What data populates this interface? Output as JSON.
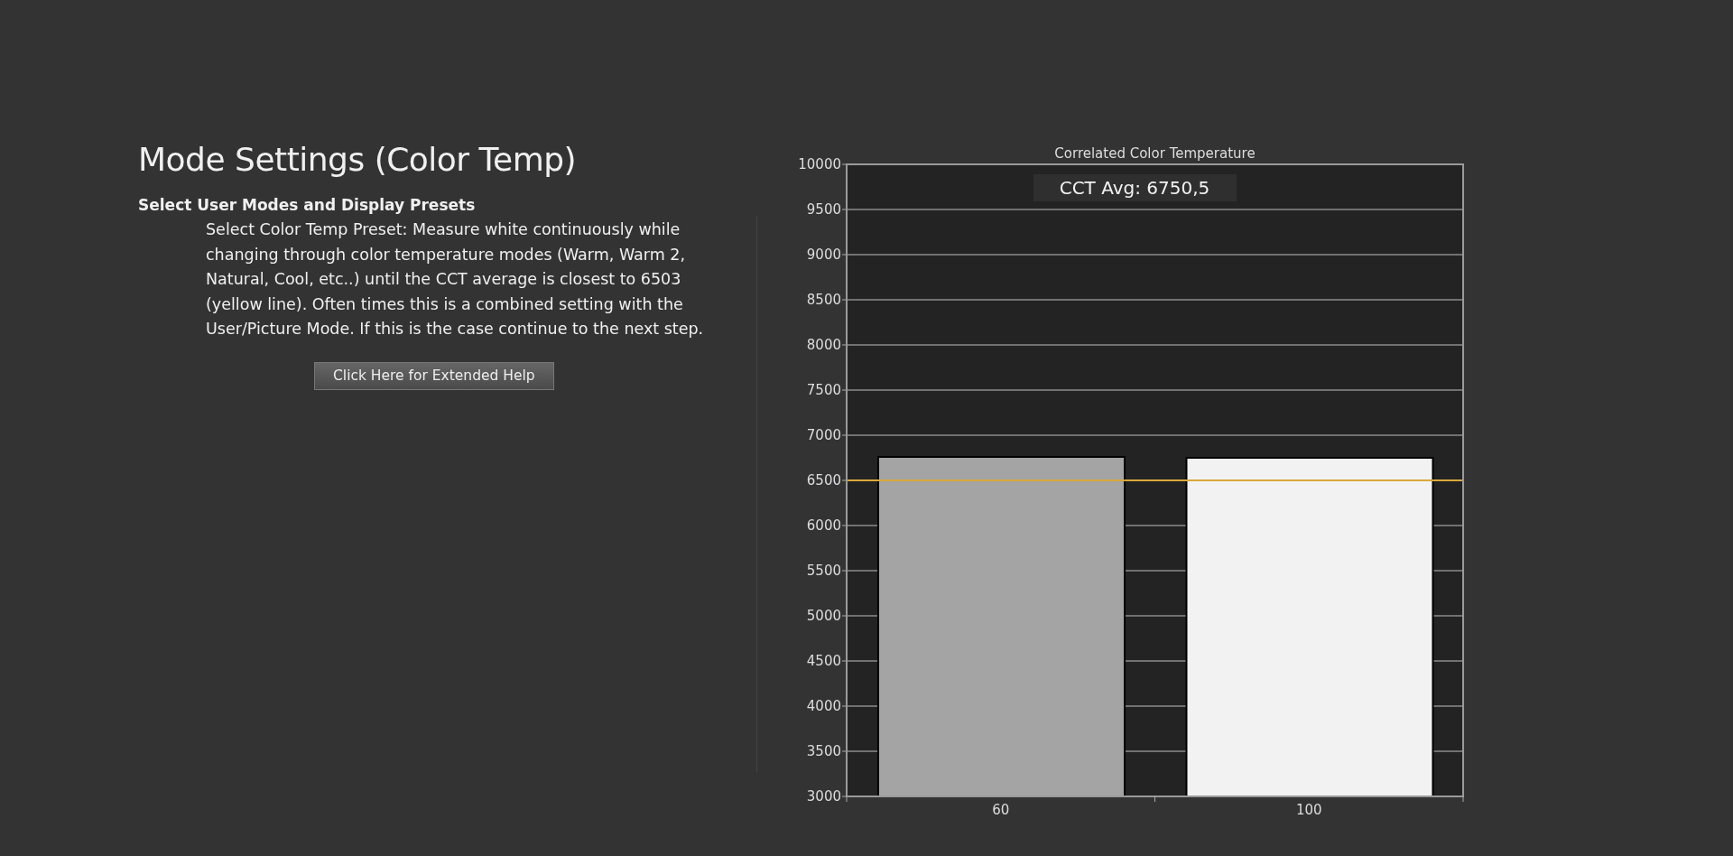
{
  "title": "Mode Settings (Color Temp)",
  "subheading": "Select User Modes and Display Presets",
  "instructions": "Select Color Temp Preset: Measure white continuously while changing through color temperature modes (Warm, Warm 2, Natural, Cool, etc..) until the CCT average is closest to 6503 (yellow line). Often times this is a combined setting with the User/Picture Mode. If this is the case continue to the next step.",
  "help_button": "Click Here for Extended Help",
  "chart": {
    "chart_data": {
      "type": "bar",
      "title": "Correlated Color Temperature",
      "categories": [
        "60",
        "100"
      ],
      "series": [
        {
          "color": "#a4a4a4",
          "values": [
            6760,
            null
          ]
        },
        {
          "color": "#f2f2f2",
          "values": [
            null,
            6750
          ]
        }
      ],
      "ylim": [
        3000,
        10000
      ],
      "yticks": [
        3000,
        3500,
        4000,
        4500,
        5000,
        5500,
        6000,
        6500,
        7000,
        7500,
        8000,
        8500,
        9000,
        9500,
        10000
      ],
      "grid": true,
      "ref_lines": [
        {
          "axis": "y",
          "value": 6500,
          "color": "#d9a93a"
        }
      ],
      "annotations": [
        {
          "text": "CCT Avg: 6750,5"
        }
      ]
    }
  }
}
